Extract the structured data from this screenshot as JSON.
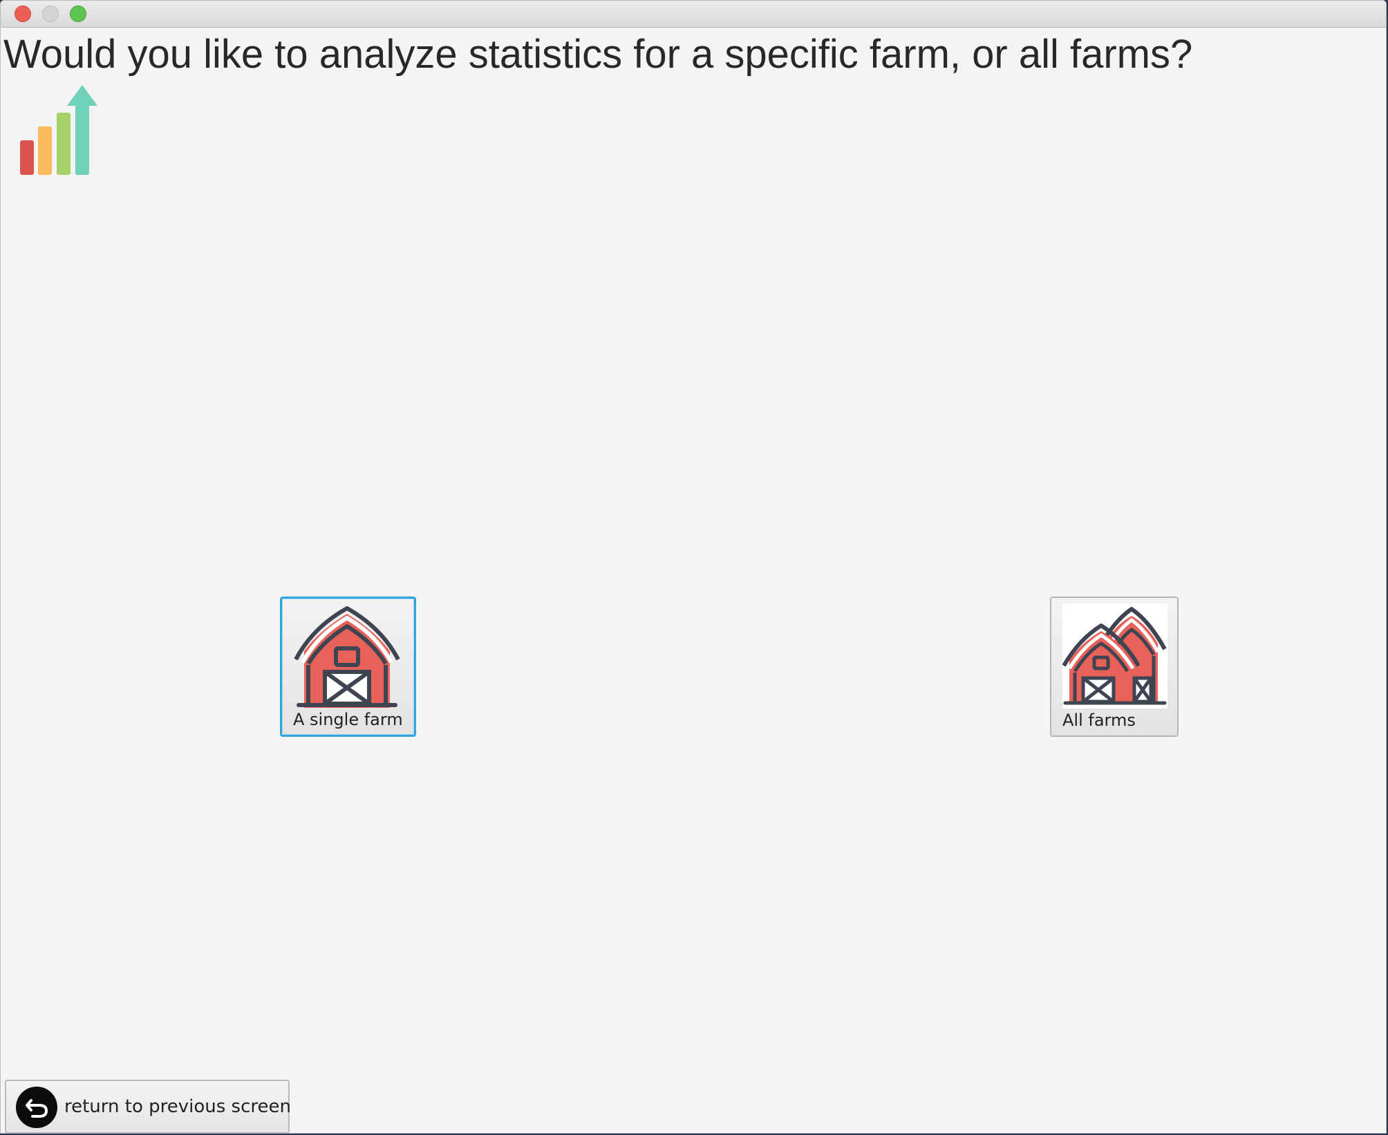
{
  "window": {
    "controls": [
      "close",
      "minimize",
      "maximize"
    ]
  },
  "prompt": {
    "question": "Would you like to analyze statistics for a specific farm, or all farms?"
  },
  "icons": {
    "header": "bar-chart-growth-icon",
    "single": "barn-icon",
    "all": "two-barns-icon",
    "back": "return-arrow-icon"
  },
  "choices": {
    "single_farm_label": "A single farm",
    "all_farms_label": "All farms"
  },
  "navigation": {
    "back_label": "return to previous screen"
  },
  "colors": {
    "focus": "#2fa4e0",
    "barn_red": "#e8625a",
    "barn_outline": "#3e4452",
    "bar1": "#d9534f",
    "bar2": "#f9b95c",
    "bar3": "#a7d26b",
    "bar4": "#6fd0bc"
  }
}
